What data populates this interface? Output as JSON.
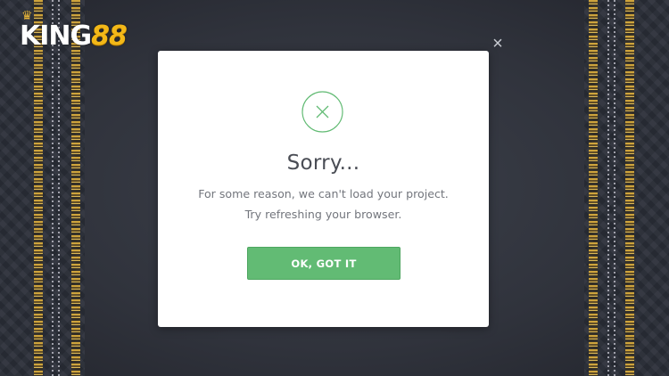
{
  "brand": {
    "name_white": "KING",
    "name_gold": "88",
    "crown_glyph": "♛",
    "gold_color": "#f3b818"
  },
  "dialog": {
    "close_glyph": "×",
    "icon": "x-circle-icon",
    "icon_color": "#62bb74",
    "title": "Sorry...",
    "message": "For some reason, we can't load your project. Try refreshing your browser.",
    "button_label": "OK, GOT IT",
    "button_color": "#62bb74"
  }
}
